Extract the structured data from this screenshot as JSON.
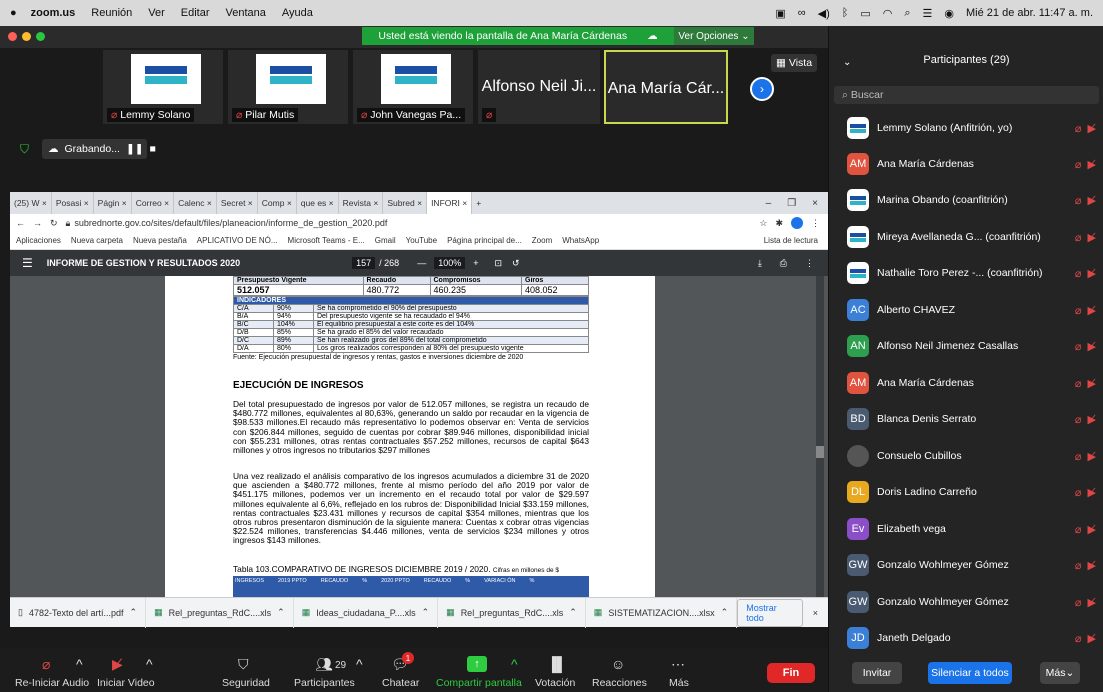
{
  "menubar": {
    "app": "zoom.us",
    "items": [
      "Reunión",
      "Ver",
      "Editar",
      "Ventana",
      "Ayuda"
    ],
    "datetime": "Mié 21 de abr.  11:47 a. m."
  },
  "share": {
    "banner": "Usted está viendo la pantalla de Ana María Cárdenas",
    "view_options": "Ver Opciones ⌄",
    "vista": "Vista"
  },
  "thumbs": [
    {
      "name": "Lemmy Solano",
      "type": "logo"
    },
    {
      "name": "Pilar Mutis",
      "type": "logo"
    },
    {
      "name": "John Vanegas Pa...",
      "type": "logo"
    },
    {
      "name": "Alfonso Neil Ji...",
      "type": "text"
    },
    {
      "name": "Ana María Cár...",
      "type": "text"
    }
  ],
  "recording": {
    "label": "Grabando..."
  },
  "browser": {
    "tabs": [
      "(25) W",
      "Posasi",
      "Págin",
      "Correo",
      "Calenc",
      "Secret",
      "Comp",
      "que es",
      "Revista",
      "Subred",
      "INFORI"
    ],
    "url": "subrednorte.gov.co/sites/default/files/planeacion/informe_de_gestion_2020.pdf",
    "bookmarks": [
      "Aplicaciones",
      "Nueva carpeta",
      "Nueva pestaña",
      "APLICATIVO DE NÓ...",
      "Microsoft Teams - E...",
      "Gmail",
      "YouTube",
      "Página principal de...",
      "Zoom",
      "WhatsApp"
    ],
    "reading_list": "Lista de lectura"
  },
  "pdf": {
    "title": "INFORME DE GESTION Y RESULTADOS 2020",
    "page": "157",
    "pages": "/ 268",
    "zoom": "100%",
    "table_head": [
      "Presupuesto Vigente",
      "Recaudo",
      "Compromisos",
      "Giros"
    ],
    "table_values": [
      "512.057",
      "480.772",
      "460.235",
      "408.052"
    ],
    "indicadores_label": "INDICADORES",
    "indicadores": [
      {
        "code": "C/A",
        "pct": "90%",
        "text": "Se ha comprometido el 90% del presupuesto"
      },
      {
        "code": "B/A",
        "pct": "94%",
        "text": "Del presupuesto vigente se ha recaudado el 94%"
      },
      {
        "code": "B/C",
        "pct": "104%",
        "text": "El equilibrio presupuestal a este corte es del 104%"
      },
      {
        "code": "D/B",
        "pct": "85%",
        "text": "Se ha girado el 85% del valor recaudado"
      },
      {
        "code": "D/C",
        "pct": "89%",
        "text": "Se han realizado giros del 89% del total comprometido"
      },
      {
        "code": "D/A",
        "pct": "80%",
        "text": "Los giros realizados corresponden al 80% del presupuesto vigente"
      }
    ],
    "source": "Fuente: Ejecución presupuestal de ingresos y rentas, gastos e inversiones diciembre de 2020",
    "heading": "EJECUCIÓN DE INGRESOS",
    "para1": "Del total presupuestado de ingresos por valor de 512.057 millones, se registra un recaudo de $480.772 millones, equivalentes al 80,63%, generando un saldo por recaudar en la vigencia de $98.533 millones.El recaudo más representativo lo podemos observar en: Venta de servicios con $206.844 millones, seguido de cuentas por cobrar $89.946 millones, disponibilidad inicial con $55.231 millones, otras rentas contractuales $57.252 millones, recursos de capital $643 millones y otros ingresos no tributarios $297 millones",
    "para2": "Una vez realizado el análisis comparativo de los ingresos acumulados a diciembre 31 de 2020 que ascienden a $480.772 millones, frente al mismo período del año 2019 por valor de $451.175 millones, podemos ver un incremento en el recaudo total por valor de $29.597 millones equivalente al 6,6%, reflejado en los rubros de: Disponibilidad Inicial $33.159 millones, rentas contractuales $23.431 millones y recursos de capital $354 millones, mientras que los otros rubros presentaron disminución de la siguiente manera: Cuentas x cobrar otras vigencias $22.524 millones, transferencias $4.446 millones, venta de servicios $234 millones y otros ingresos $143 millones.",
    "table103": "Tabla 103.COMPARATIVO DE INGRESOS DICIEMBRE 2019 / 2020.",
    "table103_unit": "Cifras en millones de $",
    "table103_head": [
      "INGRESOS",
      "2019 PPTO",
      "RECAUDO",
      "%",
      "2020 PPTO",
      "RECAUDO",
      "%",
      "VARIACI ÓN",
      "%"
    ]
  },
  "downloads": {
    "files": [
      "4782-Texto del artí...pdf",
      "Rel_preguntas_RdC....xls",
      "Ideas_ciudadana_P....xls",
      "Rel_preguntas_RdC....xls",
      "SISTEMATIZACION....xlsx"
    ],
    "show_all": "Mostrar todo"
  },
  "toolbar": {
    "audio": "Re-Iniciar Audio",
    "video": "Iniciar Video",
    "security": "Seguridad",
    "participants": "Participantes",
    "participants_count": "29",
    "chat": "Chatear",
    "chat_badge": "1",
    "share": "Compartir pantalla",
    "voting": "Votación",
    "reactions": "Reacciones",
    "more": "Más",
    "end": "Fin"
  },
  "panel": {
    "title": "Participantes (29)",
    "search": "Buscar",
    "participants": [
      {
        "name": "Lemmy Solano (Anfitrión, yo)",
        "avatar": "logo",
        "color": "#ffffff"
      },
      {
        "name": "Ana María Cárdenas",
        "avatar": "AM",
        "color": "#e0533f"
      },
      {
        "name": "Marina Obando (coanfitrión)",
        "avatar": "logo",
        "color": "#ffffff"
      },
      {
        "name": "Mireya Avellaneda G...  (coanfitrión)",
        "avatar": "logo",
        "color": "#ffffff"
      },
      {
        "name": "Nathalie Toro Perez -...  (coanfitrión)",
        "avatar": "logo",
        "color": "#ffffff"
      },
      {
        "name": "Alberto CHAVEZ",
        "avatar": "AC",
        "color": "#3b7fd6"
      },
      {
        "name": "Alfonso Neil Jimenez Casallas",
        "avatar": "AN",
        "color": "#2e9e4f"
      },
      {
        "name": "Ana María Cárdenas",
        "avatar": "AM",
        "color": "#e0533f"
      },
      {
        "name": "Blanca Denis Serrato",
        "avatar": "BD",
        "color": "#4a5a70"
      },
      {
        "name": "Consuelo Cubillos",
        "avatar": "photo",
        "color": "#555555"
      },
      {
        "name": "Doris Ladino Carreño",
        "avatar": "DL",
        "color": "#e8a820"
      },
      {
        "name": "Elizabeth vega",
        "avatar": "Ev",
        "color": "#8a4fc7"
      },
      {
        "name": "Gonzalo Wohlmeyer Gómez",
        "avatar": "GW",
        "color": "#4a5a70"
      },
      {
        "name": "Gonzalo Wohlmeyer Gómez",
        "avatar": "GW",
        "color": "#4a5a70"
      },
      {
        "name": "Janeth Delgado",
        "avatar": "JD",
        "color": "#3b7fd6"
      }
    ],
    "invite": "Invitar",
    "mute_all": "Silenciar a todos",
    "more": "Más"
  }
}
